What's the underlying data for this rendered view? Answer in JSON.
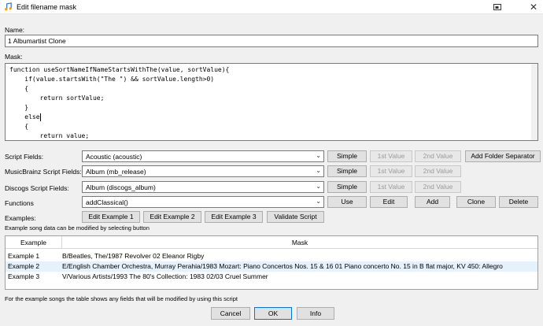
{
  "window": {
    "title": "Edit filename mask"
  },
  "name_label": "Name:",
  "name_value": "1 Albumartist Clone",
  "mask_label": "Mask:",
  "code_lines": [
    "function useSortNameIfNameStartsWithThe(value, sortValue){",
    "    if(value.startsWith(\"The \") && sortValue.length>0)",
    "    {",
    "        return sortValue;",
    "    }",
    "    else",
    "    {",
    "        return value;"
  ],
  "rows": [
    {
      "label": "Script Fields:",
      "value": "Acoustic (acoustic)",
      "b1": "Simple",
      "b2": "1st Value",
      "b3": "2nd Value",
      "b4": "Add Folder Separator"
    },
    {
      "label": "MusicBrainz Script Fields:",
      "value": "Album (mb_release)",
      "b1": "Simple",
      "b2": "1st Value",
      "b3": "2nd Value"
    },
    {
      "label": "Discogs Script Fields:",
      "value": "Album (discogs_album)",
      "b1": "Simple",
      "b2": "1st Value",
      "b3": "2nd Value"
    },
    {
      "label": "Functions",
      "value": "addClassical()",
      "b1": "Use",
      "b2": "Edit",
      "b3": "Add",
      "b4": "Clone",
      "b5": "Delete"
    }
  ],
  "examples_label": "Examples:",
  "example_buttons": [
    "Edit Example 1",
    "Edit Example 2",
    "Edit Example 3",
    "Validate Script"
  ],
  "example_note": "Example song data can be modified by selecting button",
  "table": {
    "headers": [
      "Example",
      "Mask"
    ],
    "rows": [
      {
        "example": "Example 1",
        "mask": "B/Beatles, The/1987 Revolver 02 Eleanor Rigby"
      },
      {
        "example": "Example 2",
        "mask": "E/English Chamber Orchestra, Murray Perahia/1983 Mozart: Piano Concertos Nos. 15 & 16 01 Piano concerto No. 15 in B flat major, KV 450: Allegro"
      },
      {
        "example": "Example 3",
        "mask": "V/Various Artists/1993 The 80's Collection: 1983 02/03 Cruel Summer"
      }
    ]
  },
  "footer_note": "For the example songs the table shows any fields that will be modified by using this script",
  "buttons": {
    "cancel": "Cancel",
    "ok": "OK",
    "info": "Info"
  },
  "icons": {
    "app": "music-note-icon",
    "minimize": "minimize-icon",
    "close": "close-icon",
    "window": "window-icon",
    "dropdown": "chevron-down-icon"
  }
}
